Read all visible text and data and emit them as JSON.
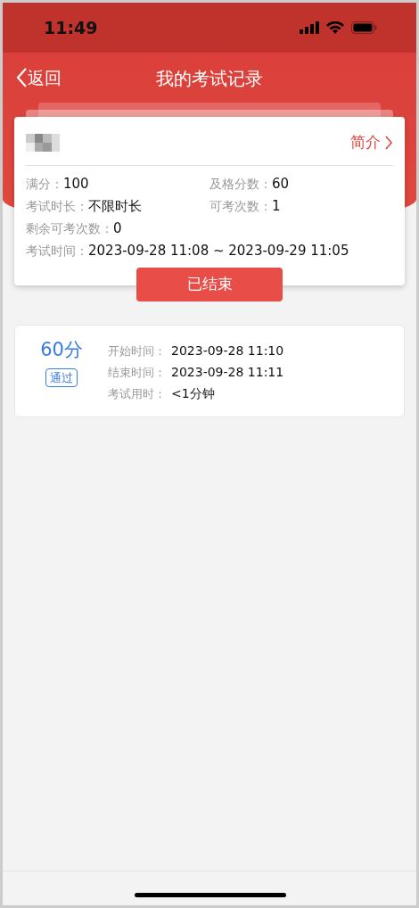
{
  "status_bar": {
    "time": "11:49"
  },
  "nav": {
    "back": "返回",
    "title": "我的考试记录"
  },
  "exam": {
    "title_redacted": true,
    "intro_link": "简介",
    "fields": [
      {
        "label": "满分：",
        "value": "100"
      },
      {
        "label": "及格分数：",
        "value": "60"
      },
      {
        "label": "考试时长：",
        "value": "不限时长"
      },
      {
        "label": "可考次数：",
        "value": "1"
      },
      {
        "label": "剩余可考次数：",
        "value": "0"
      },
      {
        "label": "考试时间：",
        "value": "2023-09-28 11:08 ~ 2023-09-29 11:05",
        "wide": true
      }
    ],
    "status_button": "已结束"
  },
  "records": [
    {
      "score": "60分",
      "result": "通过",
      "passed": true,
      "fields": [
        {
          "label": "开始时间：",
          "value": "2023-09-28 11:10"
        },
        {
          "label": "结束时间：",
          "value": "2023-09-28 11:11"
        },
        {
          "label": "考试用时：",
          "value": "<1分钟"
        }
      ]
    }
  ]
}
